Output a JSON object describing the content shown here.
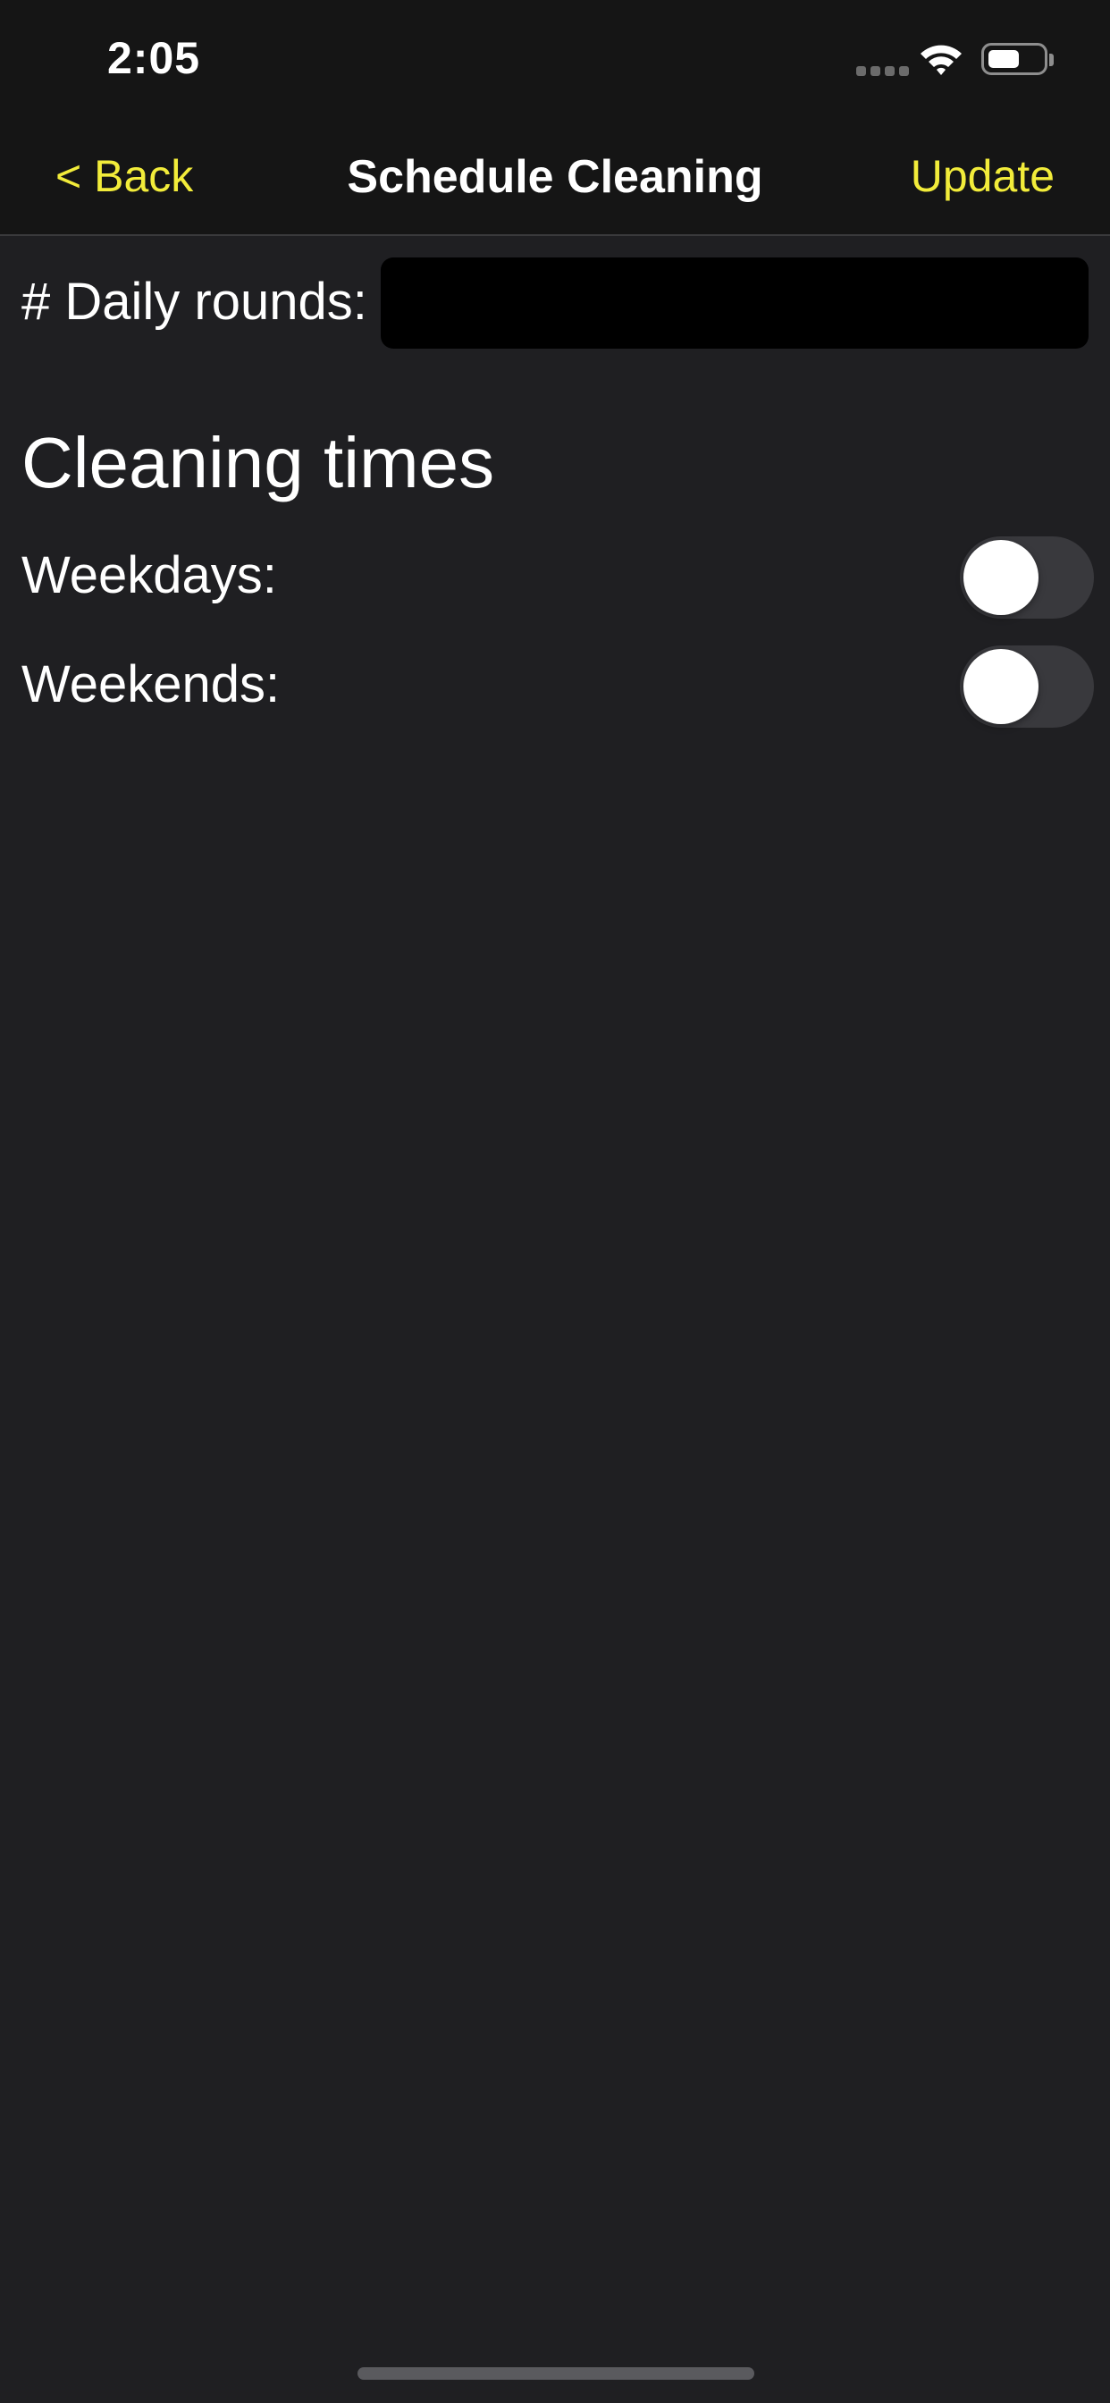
{
  "status_bar": {
    "time": "2:05",
    "icons": [
      "signal-icon",
      "wifi-icon",
      "battery-icon"
    ],
    "battery_level": 0.55
  },
  "nav": {
    "back_label": "< Back",
    "title": "Schedule Cleaning",
    "update_label": "Update"
  },
  "form": {
    "daily_rounds_label": "# Daily rounds:",
    "daily_rounds_value": "",
    "section_title": "Cleaning times",
    "weekdays_label": "Weekdays:",
    "weekdays_enabled": false,
    "weekends_label": "Weekends:",
    "weekends_enabled": false
  },
  "colors": {
    "accent": "#f2ec3a",
    "background": "#1f1f22",
    "bar_background": "#151515",
    "toggle_off": "#39393d",
    "input_background": "#000000"
  }
}
